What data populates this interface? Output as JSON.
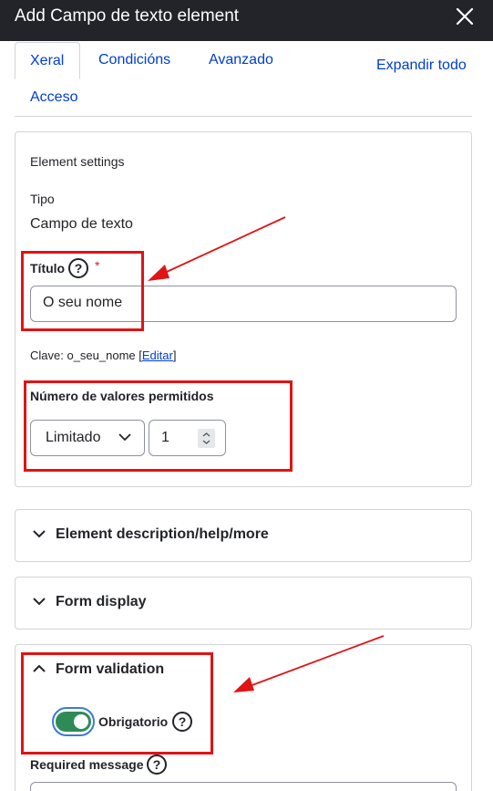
{
  "dialog": {
    "title": "Add Campo de texto element"
  },
  "tabs": [
    {
      "label": "Xeral",
      "active": true
    },
    {
      "label": "Condicións"
    },
    {
      "label": "Avanzado"
    },
    {
      "label": "Acceso"
    }
  ],
  "expand_all": "Expandir todo",
  "settings": {
    "heading": "Element settings",
    "type_label": "Tipo",
    "type_value": "Campo de texto",
    "title_label": "Título",
    "required_marker": "*",
    "title_value": "O seu nome",
    "machine_name_prefix": "Clave: o_seu_nome [",
    "machine_name_edit": "Editar",
    "machine_name_suffix": "]",
    "cardinality_label": "Número de valores permitidos",
    "cardinality_select": "Limitado",
    "cardinality_number": "1",
    "help_glyph": "?"
  },
  "accordions": [
    {
      "label": "Element description/help/more",
      "expanded": false
    },
    {
      "label": "Form display",
      "expanded": false
    },
    {
      "label": "Form validation",
      "expanded": true
    }
  ],
  "validation": {
    "required_toggle_label": "Obrigatorio",
    "required_toggle_on": true,
    "required_message_label": "Required message"
  },
  "colors": {
    "link": "#003ecc",
    "titlebar": "#232429",
    "annotation_red": "#e01414",
    "toggle_on": "#2e8b57",
    "required_star": "#dc2323"
  },
  "icons": [
    "close-icon",
    "help-icon",
    "chevron-down-icon",
    "chevron-up-icon",
    "spinner-icon"
  ]
}
